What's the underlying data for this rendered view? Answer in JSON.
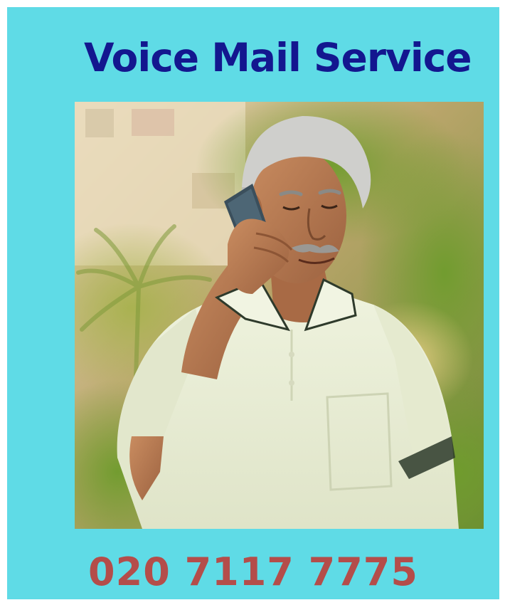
{
  "poster": {
    "title": "Voice Mail Service",
    "phone_number": "020 7117 7775"
  },
  "photo": {
    "subject": "man-on-phone-photo"
  },
  "colors": {
    "background": "#5fdbe6",
    "title": "#13178f",
    "phone_number": "#b44d4a",
    "shirt": "#e9eed6",
    "skin": "#b77a52",
    "hair": "#cfcfcc",
    "foliage": "#7fa043"
  }
}
